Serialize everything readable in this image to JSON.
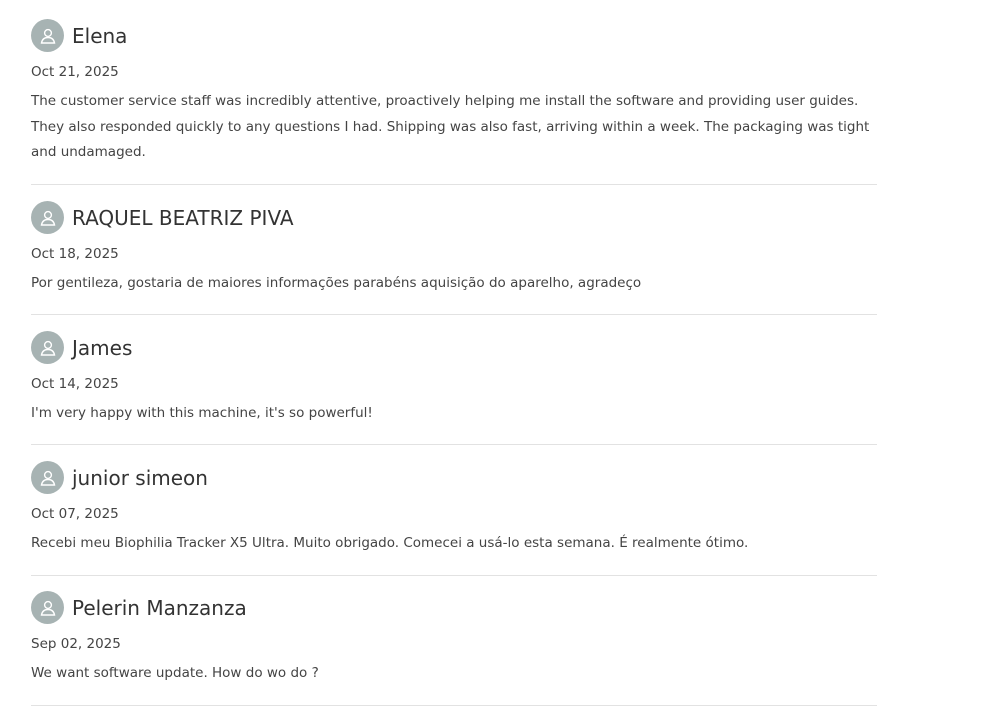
{
  "reviews": [
    {
      "name": "Elena",
      "date": "Oct 21, 2025",
      "text": "The customer service staff was incredibly attentive, proactively helping me install the software and providing user guides. They also responded quickly to any questions I had. Shipping was also fast, arriving within a week. The packaging was tight and undamaged."
    },
    {
      "name": "RAQUEL BEATRIZ PIVA",
      "date": "Oct 18, 2025",
      "text": "Por gentileza, gostaria de maiores informações parabéns aquisição do aparelho, agradeço"
    },
    {
      "name": "James",
      "date": "Oct 14, 2025",
      "text": "I'm very happy with this machine, it's so powerful!"
    },
    {
      "name": "junior simeon",
      "date": "Oct 07, 2025",
      "text": "Recebi meu Biophilia Tracker X5 Ultra. Muito obrigado. Comecei a usá-lo esta semana. É realmente ótimo."
    },
    {
      "name": "Pelerin Manzanza",
      "date": "Sep 02, 2025",
      "text": "We want software update. How do wo do ?"
    }
  ],
  "icons": {
    "avatar": "user-avatar-icon"
  },
  "colors": {
    "avatar_bg": "#a7b3b3",
    "divider": "#e2e2e2",
    "text": "#444444"
  }
}
